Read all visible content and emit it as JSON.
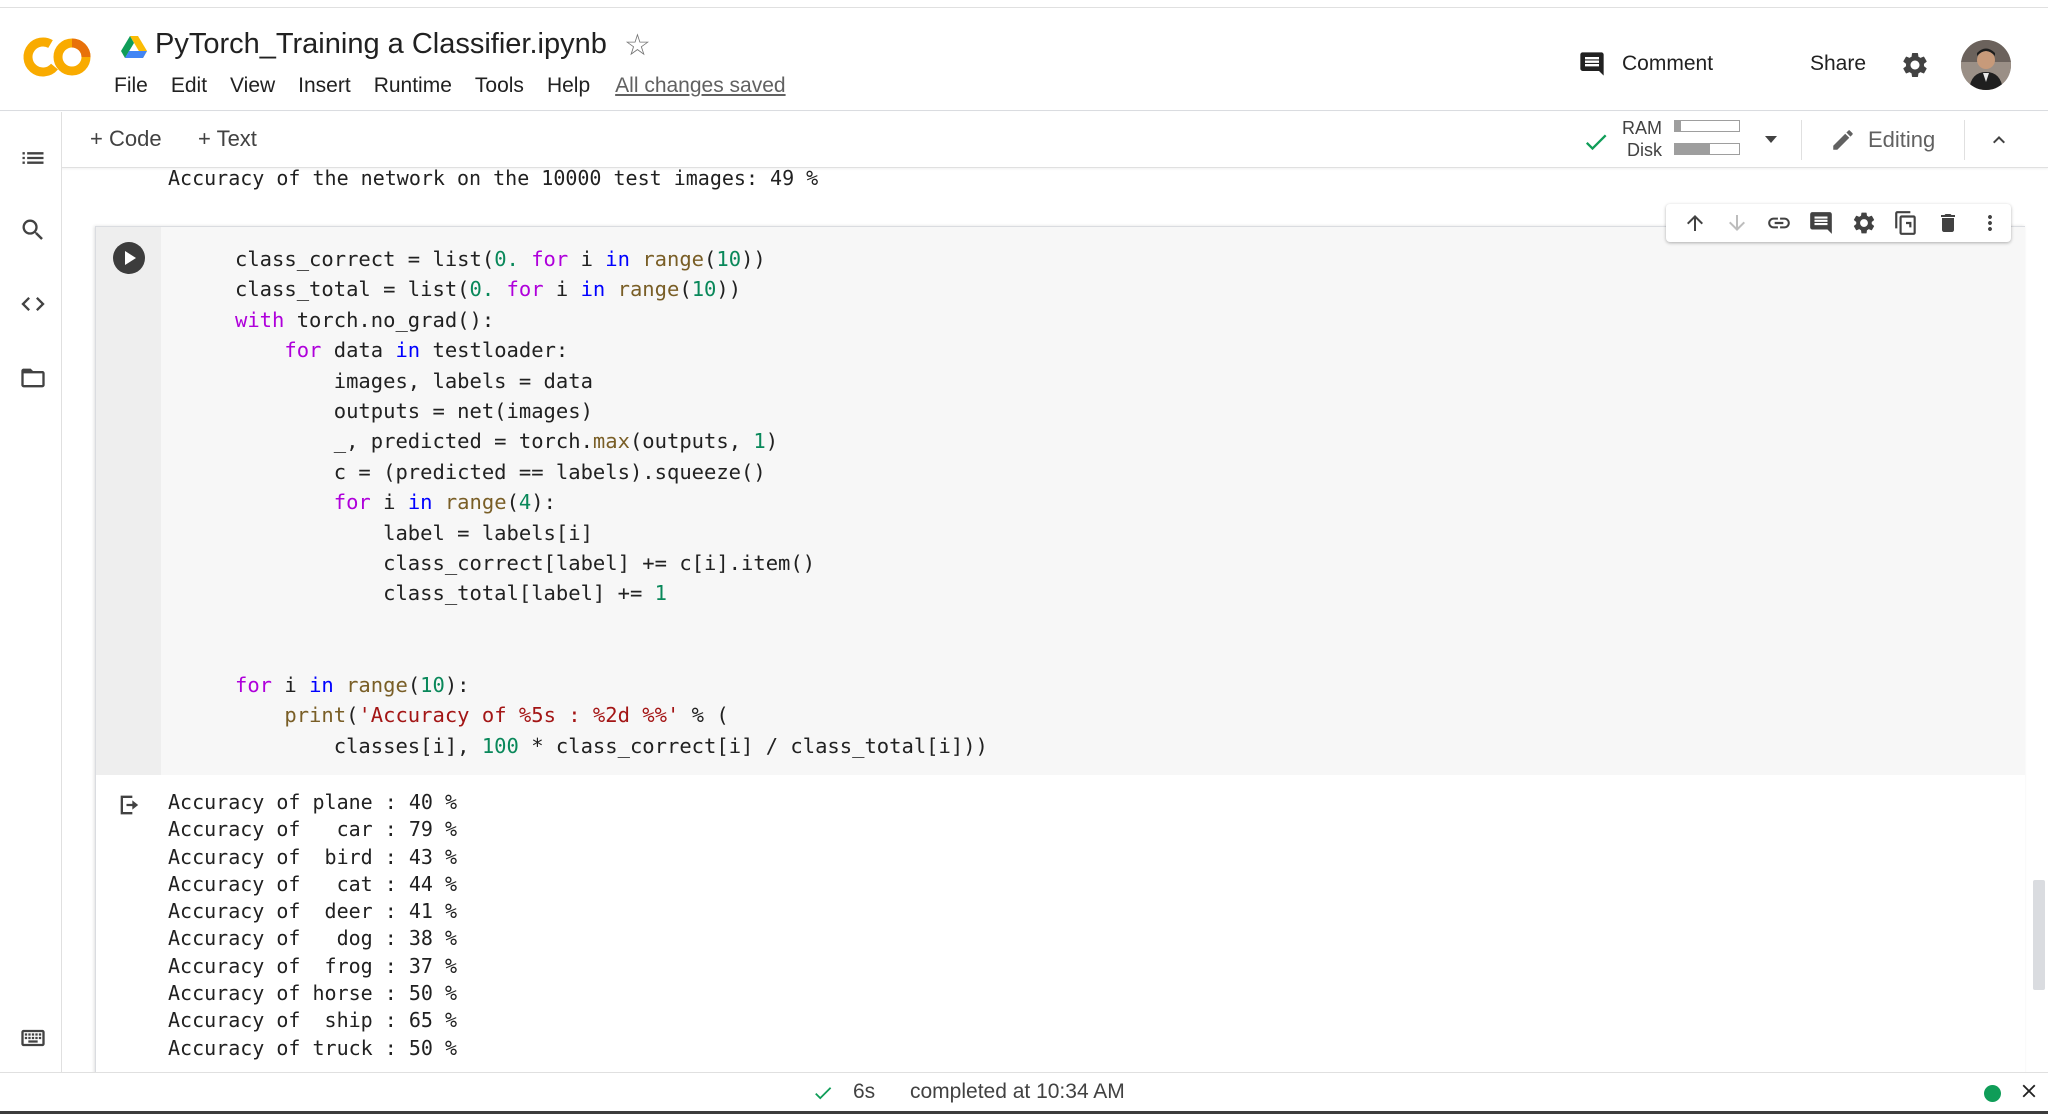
{
  "header": {
    "logo_text": "CO",
    "notebook_title": "PyTorch_Training a Classifier.ipynb",
    "menu": [
      "File",
      "Edit",
      "View",
      "Insert",
      "Runtime",
      "Tools",
      "Help"
    ],
    "save_status": "All changes saved",
    "comment_label": "Comment",
    "share_label": "Share"
  },
  "toolbar": {
    "add_code_label": "+ Code",
    "add_text_label": "+ Text",
    "ram_label": "RAM",
    "disk_label": "Disk",
    "ram_usage": 0.1,
    "disk_usage": 0.55,
    "editing_label": "Editing"
  },
  "sidebar": {
    "icons": [
      "table-of-contents-icon",
      "search-icon",
      "code-snippets-icon",
      "files-icon",
      "terminal-icon"
    ]
  },
  "previous_output": "Accuracy of the network on the 10000 test images: 49 %",
  "cell": {
    "toolbar_icons": [
      "move-up-icon",
      "move-down-icon",
      "link-icon",
      "comment-icon",
      "settings-icon",
      "mirror-cell-icon",
      "delete-icon",
      "more-icon"
    ],
    "output_lines": [
      "Accuracy of plane : 40 %",
      "Accuracy of   car : 79 %",
      "Accuracy of  bird : 43 %",
      "Accuracy of   cat : 44 %",
      "Accuracy of  deer : 41 %",
      "Accuracy of   dog : 38 %",
      "Accuracy of  frog : 37 %",
      "Accuracy of horse : 50 %",
      "Accuracy of  ship : 65 %",
      "Accuracy of truck : 50 %"
    ],
    "code": {
      "l1": {
        "a": "class_correct = list(",
        "n1": "0.",
        "b": " ",
        "k1": "for",
        "c": " i ",
        "k2": "in",
        "d": " ",
        "f": "range",
        "e": "(",
        "n2": "10",
        "g": "))"
      },
      "l2": {
        "a": "class_total = list(",
        "n1": "0.",
        "b": " ",
        "k1": "for",
        "c": " i ",
        "k2": "in",
        "d": " ",
        "f": "range",
        "e": "(",
        "n2": "10",
        "g": "))"
      },
      "l3": {
        "k1": "with",
        "a": " torch.no_grad():"
      },
      "l4": {
        "i": "    ",
        "k1": "for",
        "a": " data ",
        "k2": "in",
        "b": " testloader:"
      },
      "l5": "        images, labels = data",
      "l6": "        outputs = net(images)",
      "l7": {
        "a": "        _, predicted = torch.",
        "f": "max",
        "b": "(outputs, ",
        "n": "1",
        "c": ")"
      },
      "l8": "        c = (predicted == labels).squeeze()",
      "l9": {
        "i": "        ",
        "k1": "for",
        "a": " i ",
        "k2": "in",
        "b": " ",
        "f": "range",
        "c": "(",
        "n": "4",
        "d": "):"
      },
      "l10": "            label = labels[i]",
      "l11": "            class_correct[label] += c[i].item()",
      "l12": {
        "a": "            class_total[label] += ",
        "n": "1"
      },
      "l15": {
        "k1": "for",
        "a": " i ",
        "k2": "in",
        "b": " ",
        "f": "range",
        "c": "(",
        "n": "10",
        "d": "):"
      },
      "l16": {
        "i": "    ",
        "f": "print",
        "a": "(",
        "s": "'Accuracy of %5s : %2d %%'",
        "b": " % ("
      },
      "l17": {
        "a": "        classes[i], ",
        "n": "100",
        "b": " * class_correct[i] / class_total[i]))"
      }
    }
  },
  "status": {
    "elapsed": "6s",
    "completed": "completed at 10:34 AM"
  },
  "colors": {
    "logo_orange": "#f9ab00",
    "logo_orange_dark": "#e8710a",
    "check_green": "#0f9d58",
    "keyword": "#af00db",
    "builtin_keyword": "#0000ff",
    "number": "#09885a",
    "string": "#a31515",
    "function": "#795e26"
  }
}
